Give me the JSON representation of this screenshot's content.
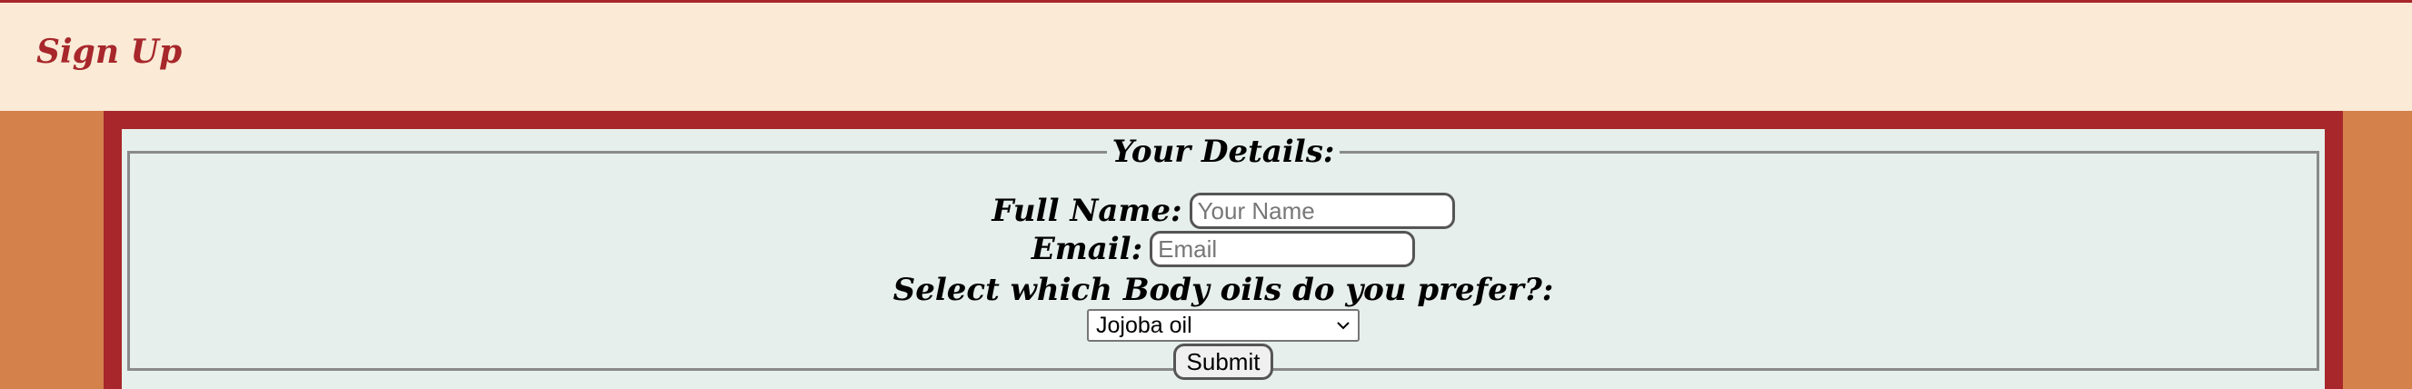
{
  "header": {
    "title": "Sign Up"
  },
  "form": {
    "legend": "Your Details:",
    "full_name": {
      "label": "Full Name:",
      "placeholder": "Your Name",
      "value": ""
    },
    "email": {
      "label": "Email:",
      "placeholder": "Email",
      "value": ""
    },
    "oils": {
      "label": "Select which Body oils do you prefer?:",
      "selected": "Jojoba oil"
    },
    "submit_label": "Submit"
  },
  "colors": {
    "header_bg": "#faead6",
    "title": "#a7272b",
    "page_bg": "#d4814c",
    "panel_border": "#a7272b",
    "form_bg": "#e6efec"
  },
  "icons": {
    "select_chevron": "chevron-down-icon"
  }
}
